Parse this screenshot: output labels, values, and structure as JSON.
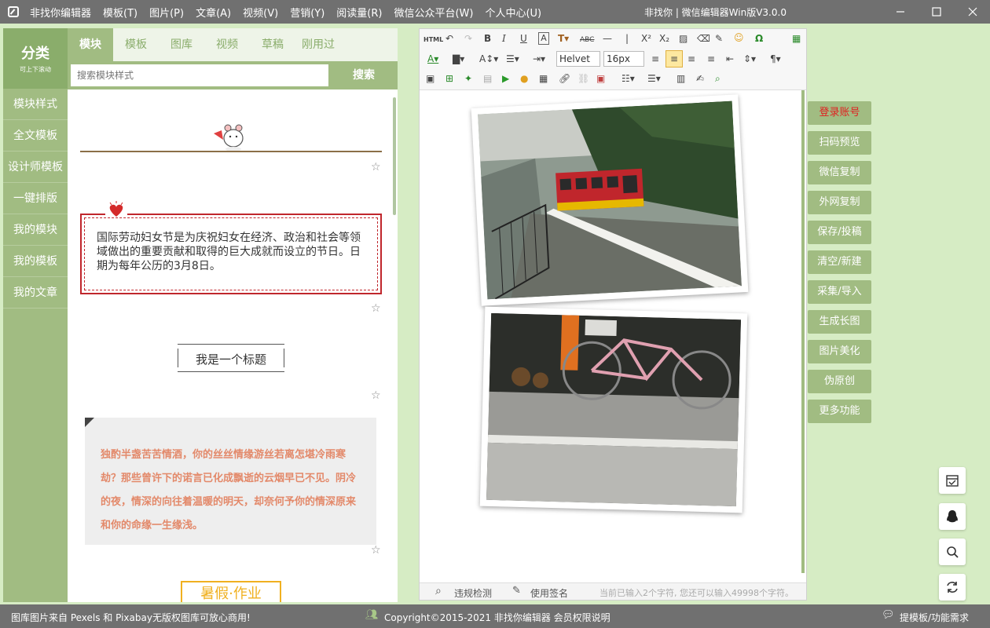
{
  "menu": {
    "app_name": "非找你编辑器",
    "items": [
      "模板(T)",
      "图片(P)",
      "文章(A)",
      "视频(V)",
      "营销(Y)",
      "阅读量(R)",
      "微信公众平台(W)",
      "个人中心(U)"
    ],
    "window_title": "非找你 | 微信编辑器Win版V3.0.0"
  },
  "categories": {
    "title": "分类",
    "subtitle": "可上下滚动",
    "items": [
      "模块样式",
      "全文模板",
      "设计师模板",
      "一键排版",
      "我的模块",
      "我的模板",
      "我的文章"
    ]
  },
  "library": {
    "tabs": [
      "模块",
      "模板",
      "图库",
      "视频",
      "草稿",
      "刚用过"
    ],
    "search_placeholder": "搜索模块样式",
    "search_button": "搜索",
    "card2_text": "国际劳动妇女节是为庆祝妇女在经济、政治和社会等领域做出的重要贡献和取得的巨大成就而设立的节日。日期为每年公历的3月8日。",
    "card3_title": "我是一个标题",
    "card4_text": "独酌半盏苦苦情酒，你的丝丝情缘游丝若离怎堪冷雨寒劫？那些曾许下的诺言已化成飘逝的云烟早已不见。阴冷的夜，情深的向往着温暖的明天，却奈何予你的情深原来和你的命缘一生缘浅。",
    "card5_text": "暑假·作业"
  },
  "toolbar": {
    "html_label": "HTML",
    "font_family": "Helvet",
    "font_size": "16px"
  },
  "editor_status": {
    "check": "违规检测",
    "signature": "使用签名",
    "count": "当前已输入2个字符, 您还可以输入49998个字符。"
  },
  "actions": [
    "登录账号",
    "扫码预览",
    "微信复制",
    "外网复制",
    "保存/投稿",
    "清空/新建",
    "采集/导入",
    "生成长图",
    "图片美化",
    "伪原创",
    "更多功能"
  ],
  "footer": {
    "left": "图库图片来自 Pexels 和 Pixabay无版权图库可放心商用!",
    "center": "Copyright©2015-2021 非找你编辑器 会员权限说明",
    "right": "提模板/功能需求"
  },
  "colors": {
    "menubar": "#707070",
    "accent_green": "#a1bc82",
    "card_red": "#c0262c",
    "quote_text": "#e3896a",
    "summer_yellow": "#f0b020"
  }
}
